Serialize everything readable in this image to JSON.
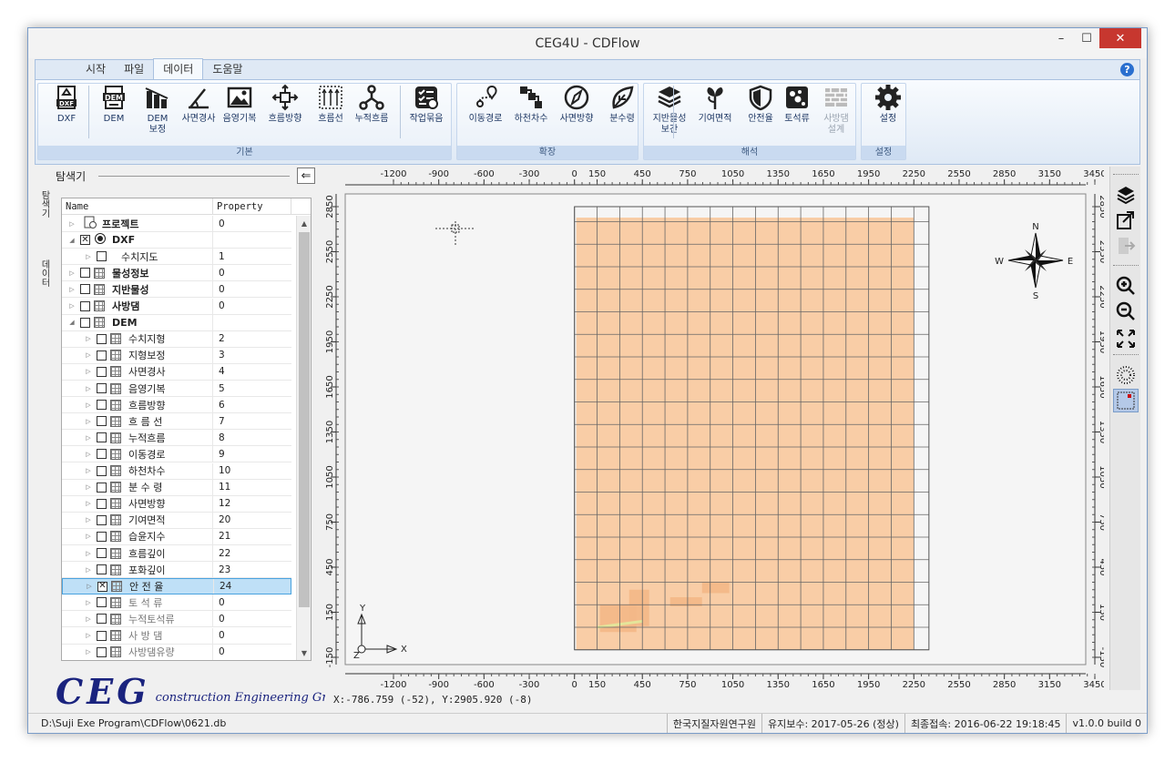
{
  "window": {
    "title": "CEG4U - CDFlow",
    "minimize": "–",
    "maximize": "☐",
    "close": "✕"
  },
  "tabs": [
    "시작",
    "파일",
    "데이터",
    "도움말"
  ],
  "ribbon": {
    "groups": [
      {
        "label": "기본",
        "buttons": [
          {
            "label": "DXF",
            "icon": "dxf-icon"
          },
          {
            "label": "DEM",
            "icon": "dem-icon"
          },
          {
            "label": "DEM\n보정",
            "icon": "dem-correction-icon"
          },
          {
            "label": "사면경사",
            "icon": "slope-icon"
          },
          {
            "label": "음영기복",
            "icon": "hillshade-icon"
          },
          {
            "label": "흐름방향",
            "icon": "flow-direction-icon"
          },
          {
            "label": "흐름선",
            "icon": "flow-line-icon"
          },
          {
            "label": "누적흐름",
            "icon": "accumulated-flow-icon"
          },
          {
            "label": "작업묶음",
            "icon": "batch-icon"
          }
        ]
      },
      {
        "label": "확장",
        "buttons": [
          {
            "label": "이동경로",
            "icon": "route-icon"
          },
          {
            "label": "하천차수",
            "icon": "stream-order-icon"
          },
          {
            "label": "사면방향",
            "icon": "aspect-icon"
          },
          {
            "label": "분수령",
            "icon": "watershed-icon"
          }
        ]
      },
      {
        "label": "해석",
        "buttons": [
          {
            "label": "지반물성\n보간",
            "icon": "layers-icon"
          },
          {
            "label": "기여면적",
            "icon": "contributing-area-icon"
          },
          {
            "label": "안전율",
            "icon": "safety-factor-icon"
          },
          {
            "label": "토석류",
            "icon": "debris-flow-icon"
          },
          {
            "label": "사방댐\n설계",
            "icon": "dam-design-icon",
            "disabled": true
          }
        ]
      },
      {
        "label": "설정",
        "buttons": [
          {
            "label": "설정",
            "icon": "settings-icon"
          }
        ]
      }
    ]
  },
  "explorer": {
    "title": "탐색기",
    "vertical_tabs": [
      "탐색기",
      "데이터"
    ],
    "columns": [
      "Name",
      "Property"
    ],
    "rows": [
      {
        "name": "프로젝트",
        "value": "0",
        "level": 0,
        "bold": true,
        "icon": "project-icon",
        "expander": "▷",
        "checkbox": false
      },
      {
        "name": "DXF",
        "value": "",
        "level": 0,
        "bold": true,
        "icon": "radio-icon",
        "expander": "◢",
        "checkbox": true,
        "checked": "✕"
      },
      {
        "name": "수치지도",
        "value": "1",
        "level": 1,
        "expander": "▷",
        "checkbox": true,
        "checked": ""
      },
      {
        "name": "물성정보",
        "value": "0",
        "level": 0,
        "bold": true,
        "expander": "▷",
        "checkbox": true,
        "checked": "",
        "grid": true
      },
      {
        "name": "지반물성",
        "value": "0",
        "level": 0,
        "bold": true,
        "expander": "▷",
        "checkbox": true,
        "checked": "",
        "grid": true
      },
      {
        "name": "사방댐",
        "value": "0",
        "level": 0,
        "bold": true,
        "expander": "▷",
        "checkbox": true,
        "checked": "",
        "grid": true
      },
      {
        "name": "DEM",
        "value": "",
        "level": 0,
        "bold": true,
        "expander": "◢",
        "checkbox": true,
        "checked": "",
        "grid": true
      },
      {
        "name": "수치지형",
        "value": "2",
        "level": 1,
        "expander": "▷",
        "checkbox": true,
        "checked": "",
        "grid": true
      },
      {
        "name": "지형보정",
        "value": "3",
        "level": 1,
        "expander": "▷",
        "checkbox": true,
        "checked": "",
        "grid": true
      },
      {
        "name": "사면경사",
        "value": "4",
        "level": 1,
        "expander": "▷",
        "checkbox": true,
        "checked": "",
        "grid": true
      },
      {
        "name": "음영기복",
        "value": "5",
        "level": 1,
        "expander": "▷",
        "checkbox": true,
        "checked": "",
        "grid": true
      },
      {
        "name": "흐름방향",
        "value": "6",
        "level": 1,
        "expander": "▷",
        "checkbox": true,
        "checked": "",
        "grid": true
      },
      {
        "name": "흐 름 선",
        "value": "7",
        "level": 1,
        "expander": "▷",
        "checkbox": true,
        "checked": "",
        "grid": true
      },
      {
        "name": "누적흐름",
        "value": "8",
        "level": 1,
        "expander": "▷",
        "checkbox": true,
        "checked": "",
        "grid": true
      },
      {
        "name": "이동경로",
        "value": "9",
        "level": 1,
        "expander": "▷",
        "checkbox": true,
        "checked": "",
        "grid": true
      },
      {
        "name": "하천차수",
        "value": "10",
        "level": 1,
        "expander": "▷",
        "checkbox": true,
        "checked": "",
        "grid": true
      },
      {
        "name": "분 수 령",
        "value": "11",
        "level": 1,
        "expander": "▷",
        "checkbox": true,
        "checked": "",
        "grid": true
      },
      {
        "name": "사면방향",
        "value": "12",
        "level": 1,
        "expander": "▷",
        "checkbox": true,
        "checked": "",
        "grid": true
      },
      {
        "name": "기여면적",
        "value": "20",
        "level": 1,
        "expander": "▷",
        "checkbox": true,
        "checked": "",
        "grid": true
      },
      {
        "name": "습윤지수",
        "value": "21",
        "level": 1,
        "expander": "▷",
        "checkbox": true,
        "checked": "",
        "grid": true
      },
      {
        "name": "흐름깊이",
        "value": "22",
        "level": 1,
        "expander": "▷",
        "checkbox": true,
        "checked": "",
        "grid": true
      },
      {
        "name": "포화깊이",
        "value": "23",
        "level": 1,
        "expander": "▷",
        "checkbox": true,
        "checked": "",
        "grid": true
      },
      {
        "name": "안 전 율",
        "value": "24",
        "level": 1,
        "expander": "▷",
        "checkbox": true,
        "checked": "✕",
        "grid": true,
        "selected": true
      },
      {
        "name": "토 석 류",
        "value": "0",
        "level": 1,
        "expander": "▷",
        "checkbox": true,
        "checked": "",
        "grid": true,
        "gray": true
      },
      {
        "name": "누적토석류",
        "value": "0",
        "level": 1,
        "expander": "▷",
        "checkbox": true,
        "checked": "",
        "grid": true,
        "gray": true
      },
      {
        "name": "사 방 댐",
        "value": "0",
        "level": 1,
        "expander": "▷",
        "checkbox": true,
        "checked": "",
        "grid": true,
        "gray": true
      },
      {
        "name": "사방댐유량",
        "value": "0",
        "level": 1,
        "expander": "▷",
        "checkbox": true,
        "checked": "",
        "grid": true,
        "gray": true
      }
    ]
  },
  "logo": {
    "big": "CEG",
    "small": "construction Engineering Group"
  },
  "map": {
    "x_ticks": [
      "-1200",
      "-900",
      "-600",
      "-300",
      "0",
      "150",
      "450",
      "750",
      "1050",
      "1350",
      "1650",
      "1950",
      "2250",
      "2550",
      "2850",
      "3150",
      "3450"
    ],
    "y_ticks": [
      "2850",
      "2550",
      "2250",
      "1950",
      "1650",
      "1350",
      "1050",
      "750",
      "450",
      "150",
      "-150"
    ],
    "compass": {
      "n": "N",
      "s": "S",
      "e": "E",
      "w": "W"
    },
    "axes": {
      "x": "X",
      "y": "Y",
      "z": "Z"
    },
    "fill_color": "#f9cda6",
    "coord_readout": "X:-786.759 (-52), Y:2905.920 (-8)"
  },
  "right_toolbar": [
    "layers-icon",
    "export-icon",
    "exit-icon",
    "zoom-in-icon",
    "zoom-out-icon",
    "fit-extent-icon",
    "grid-dots-icon",
    "grid-select-icon"
  ],
  "status": {
    "path": "D:\\Suji Exe Program\\CDFlow\\0621.db",
    "org": "한국지질자원연구원",
    "maintenance": "유지보수: 2017-05-26 (정상)",
    "last_access": "최종접속: 2016-06-22 19:18:45",
    "version": "v1.0.0 build 0"
  }
}
